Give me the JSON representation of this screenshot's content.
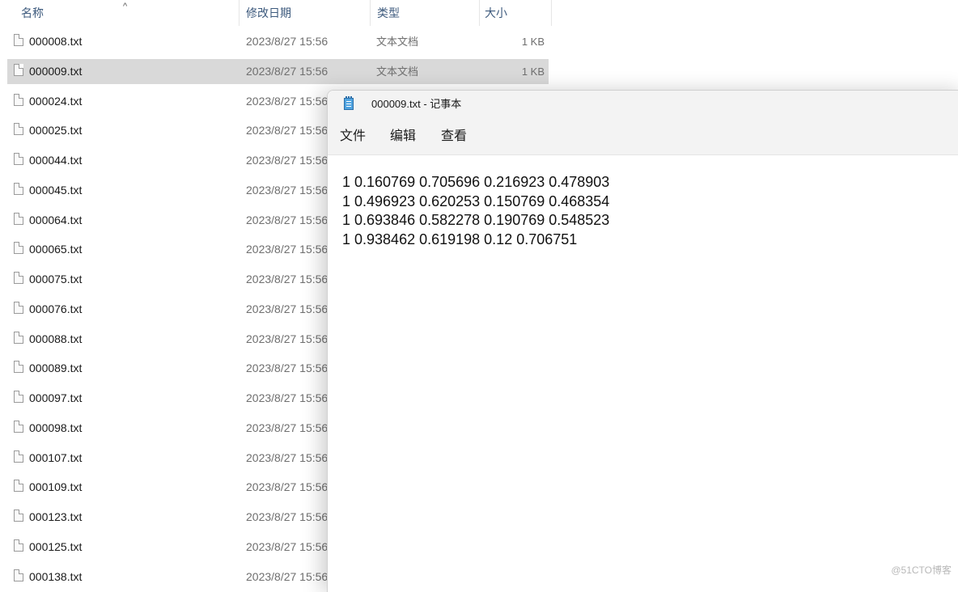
{
  "explorer": {
    "columns": {
      "name": "名称",
      "date": "修改日期",
      "type": "类型",
      "size": "大小"
    },
    "sort_indicator": "^",
    "files": [
      {
        "name": "000008.txt",
        "date": "2023/8/27 15:56",
        "type": "文本文档",
        "size": "1 KB",
        "selected": false
      },
      {
        "name": "000009.txt",
        "date": "2023/8/27 15:56",
        "type": "文本文档",
        "size": "1 KB",
        "selected": true
      },
      {
        "name": "000024.txt",
        "date": "2023/8/27 15:56",
        "type": "",
        "size": "",
        "selected": false
      },
      {
        "name": "000025.txt",
        "date": "2023/8/27 15:56",
        "type": "",
        "size": "",
        "selected": false
      },
      {
        "name": "000044.txt",
        "date": "2023/8/27 15:56",
        "type": "",
        "size": "",
        "selected": false
      },
      {
        "name": "000045.txt",
        "date": "2023/8/27 15:56",
        "type": "",
        "size": "",
        "selected": false
      },
      {
        "name": "000064.txt",
        "date": "2023/8/27 15:56",
        "type": "",
        "size": "",
        "selected": false
      },
      {
        "name": "000065.txt",
        "date": "2023/8/27 15:56",
        "type": "",
        "size": "",
        "selected": false
      },
      {
        "name": "000075.txt",
        "date": "2023/8/27 15:56",
        "type": "",
        "size": "",
        "selected": false
      },
      {
        "name": "000076.txt",
        "date": "2023/8/27 15:56",
        "type": "",
        "size": "",
        "selected": false
      },
      {
        "name": "000088.txt",
        "date": "2023/8/27 15:56",
        "type": "",
        "size": "",
        "selected": false
      },
      {
        "name": "000089.txt",
        "date": "2023/8/27 15:56",
        "type": "",
        "size": "",
        "selected": false
      },
      {
        "name": "000097.txt",
        "date": "2023/8/27 15:56",
        "type": "",
        "size": "",
        "selected": false
      },
      {
        "name": "000098.txt",
        "date": "2023/8/27 15:56",
        "type": "",
        "size": "",
        "selected": false
      },
      {
        "name": "000107.txt",
        "date": "2023/8/27 15:56",
        "type": "",
        "size": "",
        "selected": false
      },
      {
        "name": "000109.txt",
        "date": "2023/8/27 15:56",
        "type": "",
        "size": "",
        "selected": false
      },
      {
        "name": "000123.txt",
        "date": "2023/8/27 15:56",
        "type": "",
        "size": "",
        "selected": false
      },
      {
        "name": "000125.txt",
        "date": "2023/8/27 15:56",
        "type": "",
        "size": "",
        "selected": false
      },
      {
        "name": "000138.txt",
        "date": "2023/8/27 15:56",
        "type": "",
        "size": "",
        "selected": false
      }
    ]
  },
  "notepad": {
    "icon": "notepad-icon",
    "title": "000009.txt - 记事本",
    "menu": [
      "文件",
      "编辑",
      "查看"
    ],
    "lines": [
      "1 0.160769 0.705696 0.216923 0.478903",
      "1 0.496923 0.620253 0.150769 0.468354",
      "1 0.693846 0.582278 0.190769 0.548523",
      "1 0.938462 0.619198 0.12 0.706751"
    ]
  },
  "watermark": "@51CTO博客"
}
